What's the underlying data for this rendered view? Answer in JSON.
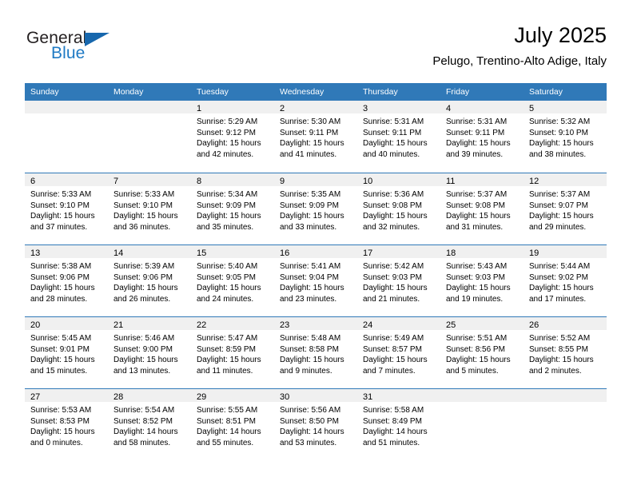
{
  "brand": {
    "name_part1": "General",
    "name_part2": "Blue",
    "triangle_icon": "triangle-icon",
    "accent_color": "#1767ad",
    "text_color": "#231f20"
  },
  "header": {
    "month_title": "July 2025",
    "location": "Pelugo, Trentino-Alto Adige, Italy"
  },
  "colors": {
    "header_blue": "#3079b8",
    "day_band_gray": "#f0f0f0",
    "text_black": "#000000",
    "white": "#ffffff"
  },
  "weekdays": [
    "Sunday",
    "Monday",
    "Tuesday",
    "Wednesday",
    "Thursday",
    "Friday",
    "Saturday"
  ],
  "weeks": [
    [
      {
        "day": "",
        "lines": []
      },
      {
        "day": "",
        "lines": []
      },
      {
        "day": "1",
        "lines": [
          "Sunrise: 5:29 AM",
          "Sunset: 9:12 PM",
          "Daylight: 15 hours",
          "and 42 minutes."
        ]
      },
      {
        "day": "2",
        "lines": [
          "Sunrise: 5:30 AM",
          "Sunset: 9:11 PM",
          "Daylight: 15 hours",
          "and 41 minutes."
        ]
      },
      {
        "day": "3",
        "lines": [
          "Sunrise: 5:31 AM",
          "Sunset: 9:11 PM",
          "Daylight: 15 hours",
          "and 40 minutes."
        ]
      },
      {
        "day": "4",
        "lines": [
          "Sunrise: 5:31 AM",
          "Sunset: 9:11 PM",
          "Daylight: 15 hours",
          "and 39 minutes."
        ]
      },
      {
        "day": "5",
        "lines": [
          "Sunrise: 5:32 AM",
          "Sunset: 9:10 PM",
          "Daylight: 15 hours",
          "and 38 minutes."
        ]
      }
    ],
    [
      {
        "day": "6",
        "lines": [
          "Sunrise: 5:33 AM",
          "Sunset: 9:10 PM",
          "Daylight: 15 hours",
          "and 37 minutes."
        ]
      },
      {
        "day": "7",
        "lines": [
          "Sunrise: 5:33 AM",
          "Sunset: 9:10 PM",
          "Daylight: 15 hours",
          "and 36 minutes."
        ]
      },
      {
        "day": "8",
        "lines": [
          "Sunrise: 5:34 AM",
          "Sunset: 9:09 PM",
          "Daylight: 15 hours",
          "and 35 minutes."
        ]
      },
      {
        "day": "9",
        "lines": [
          "Sunrise: 5:35 AM",
          "Sunset: 9:09 PM",
          "Daylight: 15 hours",
          "and 33 minutes."
        ]
      },
      {
        "day": "10",
        "lines": [
          "Sunrise: 5:36 AM",
          "Sunset: 9:08 PM",
          "Daylight: 15 hours",
          "and 32 minutes."
        ]
      },
      {
        "day": "11",
        "lines": [
          "Sunrise: 5:37 AM",
          "Sunset: 9:08 PM",
          "Daylight: 15 hours",
          "and 31 minutes."
        ]
      },
      {
        "day": "12",
        "lines": [
          "Sunrise: 5:37 AM",
          "Sunset: 9:07 PM",
          "Daylight: 15 hours",
          "and 29 minutes."
        ]
      }
    ],
    [
      {
        "day": "13",
        "lines": [
          "Sunrise: 5:38 AM",
          "Sunset: 9:06 PM",
          "Daylight: 15 hours",
          "and 28 minutes."
        ]
      },
      {
        "day": "14",
        "lines": [
          "Sunrise: 5:39 AM",
          "Sunset: 9:06 PM",
          "Daylight: 15 hours",
          "and 26 minutes."
        ]
      },
      {
        "day": "15",
        "lines": [
          "Sunrise: 5:40 AM",
          "Sunset: 9:05 PM",
          "Daylight: 15 hours",
          "and 24 minutes."
        ]
      },
      {
        "day": "16",
        "lines": [
          "Sunrise: 5:41 AM",
          "Sunset: 9:04 PM",
          "Daylight: 15 hours",
          "and 23 minutes."
        ]
      },
      {
        "day": "17",
        "lines": [
          "Sunrise: 5:42 AM",
          "Sunset: 9:03 PM",
          "Daylight: 15 hours",
          "and 21 minutes."
        ]
      },
      {
        "day": "18",
        "lines": [
          "Sunrise: 5:43 AM",
          "Sunset: 9:03 PM",
          "Daylight: 15 hours",
          "and 19 minutes."
        ]
      },
      {
        "day": "19",
        "lines": [
          "Sunrise: 5:44 AM",
          "Sunset: 9:02 PM",
          "Daylight: 15 hours",
          "and 17 minutes."
        ]
      }
    ],
    [
      {
        "day": "20",
        "lines": [
          "Sunrise: 5:45 AM",
          "Sunset: 9:01 PM",
          "Daylight: 15 hours",
          "and 15 minutes."
        ]
      },
      {
        "day": "21",
        "lines": [
          "Sunrise: 5:46 AM",
          "Sunset: 9:00 PM",
          "Daylight: 15 hours",
          "and 13 minutes."
        ]
      },
      {
        "day": "22",
        "lines": [
          "Sunrise: 5:47 AM",
          "Sunset: 8:59 PM",
          "Daylight: 15 hours",
          "and 11 minutes."
        ]
      },
      {
        "day": "23",
        "lines": [
          "Sunrise: 5:48 AM",
          "Sunset: 8:58 PM",
          "Daylight: 15 hours",
          "and 9 minutes."
        ]
      },
      {
        "day": "24",
        "lines": [
          "Sunrise: 5:49 AM",
          "Sunset: 8:57 PM",
          "Daylight: 15 hours",
          "and 7 minutes."
        ]
      },
      {
        "day": "25",
        "lines": [
          "Sunrise: 5:51 AM",
          "Sunset: 8:56 PM",
          "Daylight: 15 hours",
          "and 5 minutes."
        ]
      },
      {
        "day": "26",
        "lines": [
          "Sunrise: 5:52 AM",
          "Sunset: 8:55 PM",
          "Daylight: 15 hours",
          "and 2 minutes."
        ]
      }
    ],
    [
      {
        "day": "27",
        "lines": [
          "Sunrise: 5:53 AM",
          "Sunset: 8:53 PM",
          "Daylight: 15 hours",
          "and 0 minutes."
        ]
      },
      {
        "day": "28",
        "lines": [
          "Sunrise: 5:54 AM",
          "Sunset: 8:52 PM",
          "Daylight: 14 hours",
          "and 58 minutes."
        ]
      },
      {
        "day": "29",
        "lines": [
          "Sunrise: 5:55 AM",
          "Sunset: 8:51 PM",
          "Daylight: 14 hours",
          "and 55 minutes."
        ]
      },
      {
        "day": "30",
        "lines": [
          "Sunrise: 5:56 AM",
          "Sunset: 8:50 PM",
          "Daylight: 14 hours",
          "and 53 minutes."
        ]
      },
      {
        "day": "31",
        "lines": [
          "Sunrise: 5:58 AM",
          "Sunset: 8:49 PM",
          "Daylight: 14 hours",
          "and 51 minutes."
        ]
      },
      {
        "day": "",
        "lines": []
      },
      {
        "day": "",
        "lines": []
      }
    ]
  ]
}
